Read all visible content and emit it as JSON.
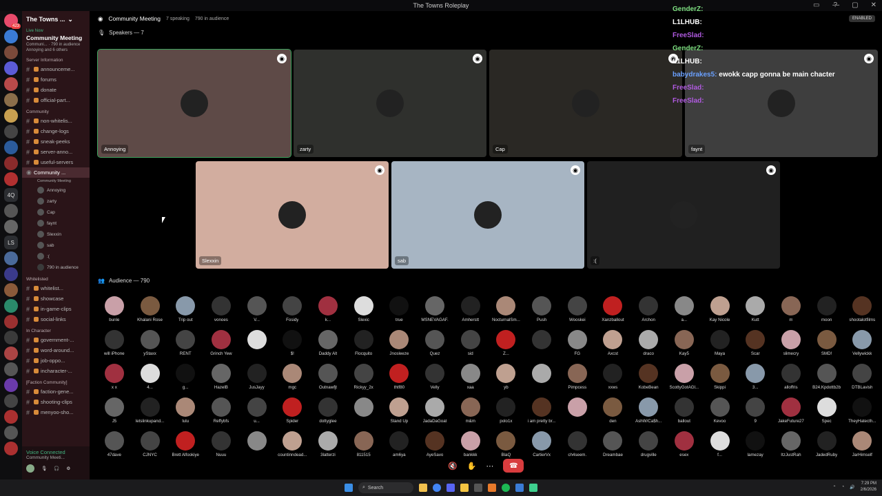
{
  "window": {
    "title": "The Towns Roleplay"
  },
  "servers": [
    {
      "color": "#e84b6b",
      "badge": "423"
    },
    {
      "color": "#3a7bd5"
    },
    {
      "color": "#7a4a3a"
    },
    {
      "color": "#5b5bd6"
    },
    {
      "color": "#b84a4a"
    },
    {
      "color": "#8a6e4a"
    },
    {
      "color": "#c8a050"
    },
    {
      "color": "#444"
    },
    {
      "color": "#2b5b9b"
    },
    {
      "color": "#8a2b2b"
    },
    {
      "color": "#b03030"
    },
    {
      "text": "4Q"
    },
    {
      "color": "#555"
    },
    {
      "color": "#666"
    },
    {
      "text": "LS"
    },
    {
      "color": "#4a6a9a"
    },
    {
      "color": "#3a3a8a"
    },
    {
      "color": "#8a5a3a"
    },
    {
      "color": "#2a8a6a"
    },
    {
      "color": "#9a3030"
    },
    {
      "color": "#3a3a3a"
    },
    {
      "color": "#aa4444"
    },
    {
      "color": "#555"
    },
    {
      "color": "#6a3aaa"
    },
    {
      "color": "#444"
    },
    {
      "color": "#aa3030"
    },
    {
      "color": "#555"
    },
    {
      "color": "#aa3030"
    }
  ],
  "sidebar": {
    "server_name": "The Towns ...",
    "live_label": "Live Now",
    "live_title": "Community Meeting",
    "live_sub": "Communi... · 790 in audience",
    "live_people": "Annoying and 6 others",
    "categories": {
      "server_info": "Server Information",
      "community": "Community",
      "whitelisted": "Whitelisted",
      "in_character": "In Character",
      "faction": "[Faction Community]"
    },
    "server_info_channels": [
      "announceme...",
      "forums",
      "donate",
      "official-part..."
    ],
    "community_channels": [
      "non-whitelis...",
      "change-logs",
      "sneak-peeks",
      "server-anno...",
      "useful-servers"
    ],
    "stage_channel": "Community ...",
    "stage_sub": "Community Meeting",
    "voice_members": [
      "Annoying",
      "zarty",
      "Cap",
      "faynt",
      "Slexxin",
      "sab",
      ":("
    ],
    "audience_count": "790 in audience",
    "whitelisted_channels": [
      "whitelist...",
      "showcase",
      "in-game-clips",
      "social-links"
    ],
    "in_character_channels": [
      "government-...",
      "word-around...",
      "job-oppo...",
      "incharacter-..."
    ],
    "faction_channels": [
      "faction-gene...",
      "shooting-clips",
      "menyoo-sho..."
    ],
    "voice_connected": "Voice Connected",
    "voice_connected_sub": "Community Meeti..."
  },
  "header": {
    "channel": "Community Meeting",
    "speaking": "7 speaking",
    "audience": "790 in audience",
    "enabled": "ENABLED"
  },
  "speakers_label": "Speakers — 7",
  "speakers": [
    {
      "name": "Annoying",
      "bg": "#5e4a47"
    },
    {
      "name": "zarty",
      "bg": "#2f302d"
    },
    {
      "name": "Cap",
      "bg": "#2a2824"
    },
    {
      "name": "faynt",
      "bg": "#3e3e3e"
    },
    {
      "name": "Slexxin",
      "bg": "#d2ad9f"
    },
    {
      "name": "sab",
      "bg": "#a7b5c3"
    },
    {
      "name": ":(",
      "bg": "#202020"
    }
  ],
  "audience_label": "Audience — 790",
  "audience": [
    [
      "bunle",
      "Khalani Rose",
      "Trip out",
      "vonoes",
      "V...",
      "Fosidy",
      "k...",
      "Slexic",
      "true",
      "MSNEVAGAF.",
      "Amherstt",
      "NocturnalSm...",
      "Push",
      "Wooskei",
      "Xanzballout",
      "Archon",
      "a...",
      "Kay Nicole",
      "Kutt",
      "m",
      "moon",
      "shootalotfilms"
    ],
    [
      "will iPhone",
      "yStaxx",
      "RENT",
      "Grinch Yew",
      "",
      "$!",
      "Daddy Alt",
      "Flocquito",
      "Jnosleeze",
      "Quez",
      "sid",
      "Z...",
      "",
      "FG",
      "Axcst",
      "draco",
      "Kay5",
      "Maya",
      "Scar",
      "slimecry",
      "SMD!",
      "Vellywickk"
    ],
    [
      "x x",
      "4...",
      "g...",
      "HazelB",
      "JusJayy",
      "mgc",
      "Outnawfjt",
      "Rickyy_2x",
      "thtf80",
      "Velly",
      "xaa",
      "yb",
      "",
      "Pimpcess",
      "xxws",
      "KobeBean",
      "ScottyGotAGl...",
      "Skippi",
      "3...",
      "alloffris",
      "B24.Kpdottb2b",
      "DTBLavish"
    ],
    [
      "J5",
      "letslinkupand...",
      "lulu",
      "Reffybfs",
      "u...",
      "Spider",
      "dottyglee",
      "",
      "Stand Up",
      "JadaDaGoat",
      "m&m",
      "polo1x",
      "i am pretty br...",
      "",
      "den",
      "AshW/Ca$h...",
      "ballout",
      "Kevoo",
      "9",
      "JakeFuture27",
      "Spec",
      "TheyHatecth..."
    ],
    [
      "47dave",
      "CJNYC",
      "Brett Alfookiye",
      "Nuuu",
      "",
      "countinndead...",
      "3latterzi",
      "811515",
      "am6ya",
      "AyeSavo",
      "bankkk",
      "BlaQ",
      "CartierVx",
      "ch4seem.",
      "Dreambae",
      "drugville",
      "esex",
      "f...",
      "lamezay",
      "ItzJustRah",
      "JadedRuby",
      "JarHimself"
    ]
  ],
  "audience_colors": [
    "#c9a0a8",
    "#7a5a40",
    "#8899aa",
    "#333",
    "#555",
    "#444",
    "#a03040",
    "#ddd",
    "#111",
    "#666",
    "#222",
    "#aa8877",
    "#555",
    "#444",
    "#c02020",
    "#333",
    "#888",
    "#bfa090",
    "#aaa",
    "#886655",
    "#222",
    "#553322"
  ],
  "chat": [
    {
      "user": "GenderZ:",
      "color": "#7ee081",
      "msg": ""
    },
    {
      "user": "L1LHUB:",
      "color": "#ffffff",
      "msg": ""
    },
    {
      "user": "FreeSlad:",
      "color": "#b05ae0",
      "msg": ""
    },
    {
      "user": "GenderZ:",
      "color": "#7ee081",
      "msg": ""
    },
    {
      "user": "L1LHUB:",
      "color": "#ffffff",
      "msg": ""
    },
    {
      "user": "babydrakes5:",
      "color": "#6aa0ff",
      "msg": "ewokk capp gonna be main chacter"
    },
    {
      "user": "FreeSlad:",
      "color": "#b05ae0",
      "msg": ""
    },
    {
      "user": "FreeSlad:",
      "color": "#b05ae0",
      "msg": ""
    }
  ],
  "taskbar": {
    "search": "Search",
    "time": "7:29 PM",
    "date": "2/6/2026"
  }
}
